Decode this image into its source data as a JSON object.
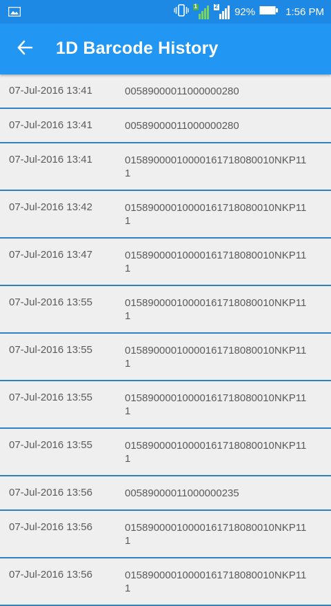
{
  "status_bar": {
    "battery": "92%",
    "time": "1:56 PM",
    "sim1": "1",
    "sim2": "2"
  },
  "app_bar": {
    "title": "1D Barcode History"
  },
  "colors": {
    "status_bar": "#1e88e5",
    "app_bar": "#2196f3",
    "divider": "#2f7fc3",
    "background": "#efefef",
    "text": "#5a5a5a"
  },
  "history": [
    {
      "date": "07-Jul-2016 13:41",
      "code": "00589000011000000280"
    },
    {
      "date": "07-Jul-2016 13:41",
      "code": "00589000011000000280"
    },
    {
      "date": "07-Jul-2016 13:41",
      "code": "015890000100001617180800​10NKP11\n1"
    },
    {
      "date": "07-Jul-2016 13:42",
      "code": "0158900001000016171808​0010NKP11\n1"
    },
    {
      "date": "07-Jul-2016 13:47",
      "code": "0158900001000016171808​0010NKP11\n1"
    },
    {
      "date": "07-Jul-2016 13:55",
      "code": "0158900001000016171808​0010NKP11\n1"
    },
    {
      "date": "07-Jul-2016 13:55",
      "code": "0158900001000016171808​0010NKP11\n1"
    },
    {
      "date": "07-Jul-2016 13:55",
      "code": "0158900001000016171808​0010NKP11\n1"
    },
    {
      "date": "07-Jul-2016 13:55",
      "code": "0158900001000016171808​0010NKP11\n1"
    },
    {
      "date": "07-Jul-2016 13:56",
      "code": "00589000011000000235"
    },
    {
      "date": "07-Jul-2016 13:56",
      "code": "0158900001000016171808​0010NKP11\n1"
    },
    {
      "date": "07-Jul-2016 13:56",
      "code": "0158900001000016171808​0010NKP11\n1"
    }
  ]
}
